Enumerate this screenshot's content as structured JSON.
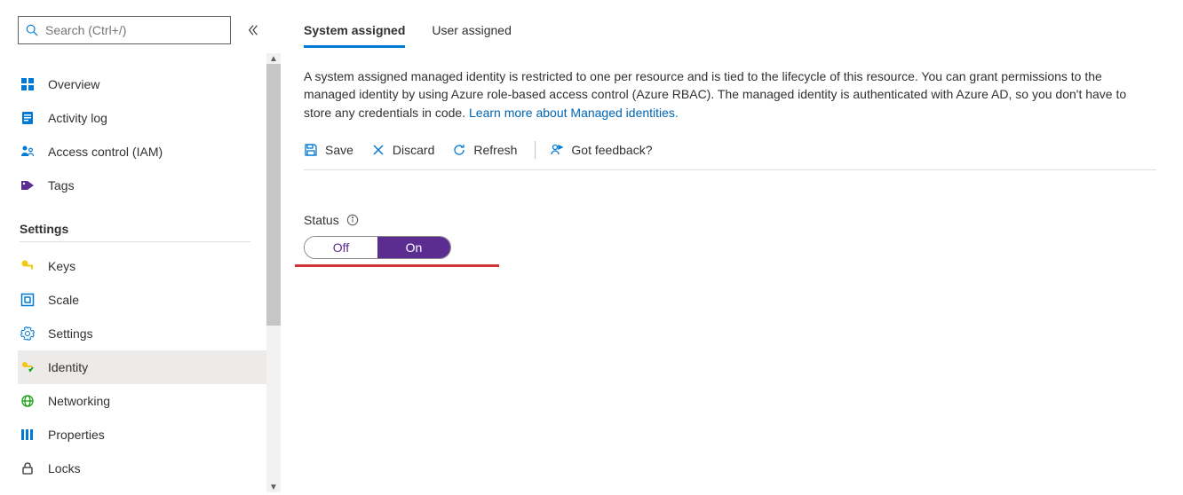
{
  "sidebar": {
    "search_placeholder": "Search (Ctrl+/)",
    "items": [
      {
        "label": "Overview"
      },
      {
        "label": "Activity log"
      },
      {
        "label": "Access control (IAM)"
      },
      {
        "label": "Tags"
      }
    ],
    "section_header": "Settings",
    "settings_items": [
      {
        "label": "Keys"
      },
      {
        "label": "Scale"
      },
      {
        "label": "Settings"
      },
      {
        "label": "Identity"
      },
      {
        "label": "Networking"
      },
      {
        "label": "Properties"
      },
      {
        "label": "Locks"
      }
    ],
    "selected_setting": "Identity"
  },
  "tabs": {
    "system": "System assigned",
    "user": "User assigned",
    "active": "system"
  },
  "description_text": "A system assigned managed identity is restricted to one per resource and is tied to the lifecycle of this resource. You can grant permissions to the managed identity by using Azure role-based access control (Azure RBAC). The managed identity is authenticated with Azure AD, so you don't have to store any credentials in code. ",
  "description_link": "Learn more about Managed identities.",
  "cmdbar": {
    "save": "Save",
    "discard": "Discard",
    "refresh": "Refresh",
    "feedback": "Got feedback?"
  },
  "status": {
    "label": "Status",
    "off_label": "Off",
    "on_label": "On",
    "value": "On"
  },
  "colors": {
    "accent": "#0078d4",
    "toggle_on": "#5c2d91",
    "annotation": "#d13438"
  }
}
